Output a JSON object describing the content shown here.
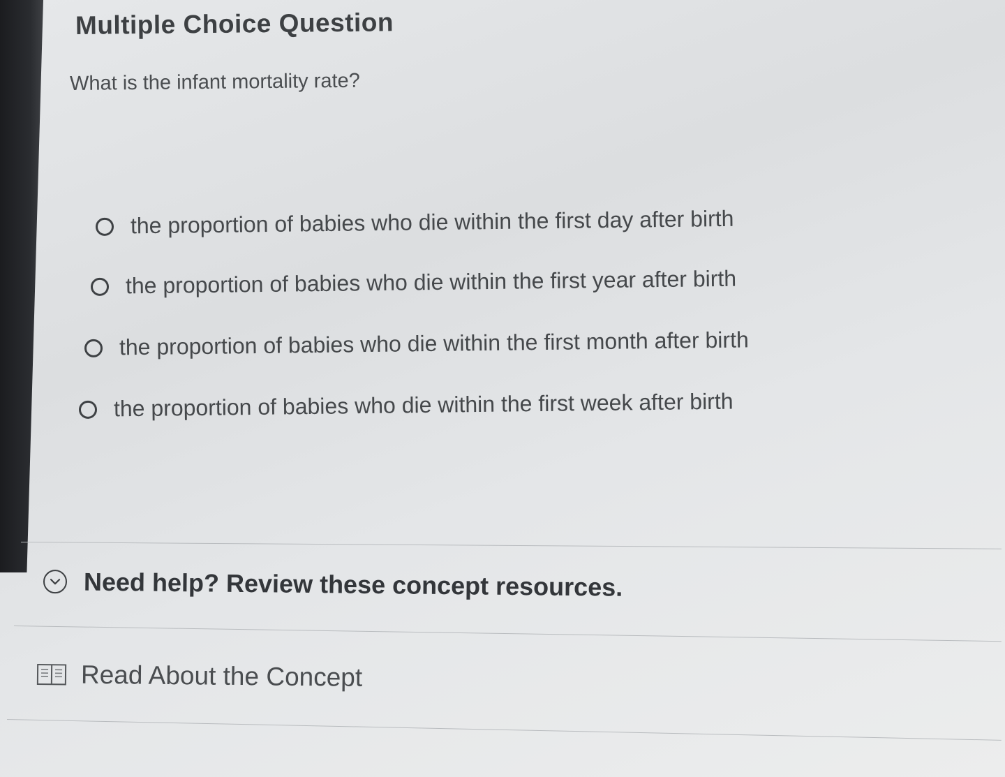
{
  "header": {
    "title": "Multiple Choice Question"
  },
  "question": {
    "text": "What is the infant mortality rate?"
  },
  "choices": [
    {
      "label": "the proportion of babies who die within the first day after birth",
      "selected": false
    },
    {
      "label": "the proportion of babies who die within the first year after birth",
      "selected": false
    },
    {
      "label": "the proportion of babies who die within the first month after birth",
      "selected": false
    },
    {
      "label": "the proportion of babies who die within the first week after birth",
      "selected": false
    }
  ],
  "help": {
    "label": "Need help? Review these concept resources.",
    "icon": "chevron-down-circle-icon"
  },
  "resources": [
    {
      "label": "Read About the Concept",
      "icon": "book-icon"
    }
  ]
}
